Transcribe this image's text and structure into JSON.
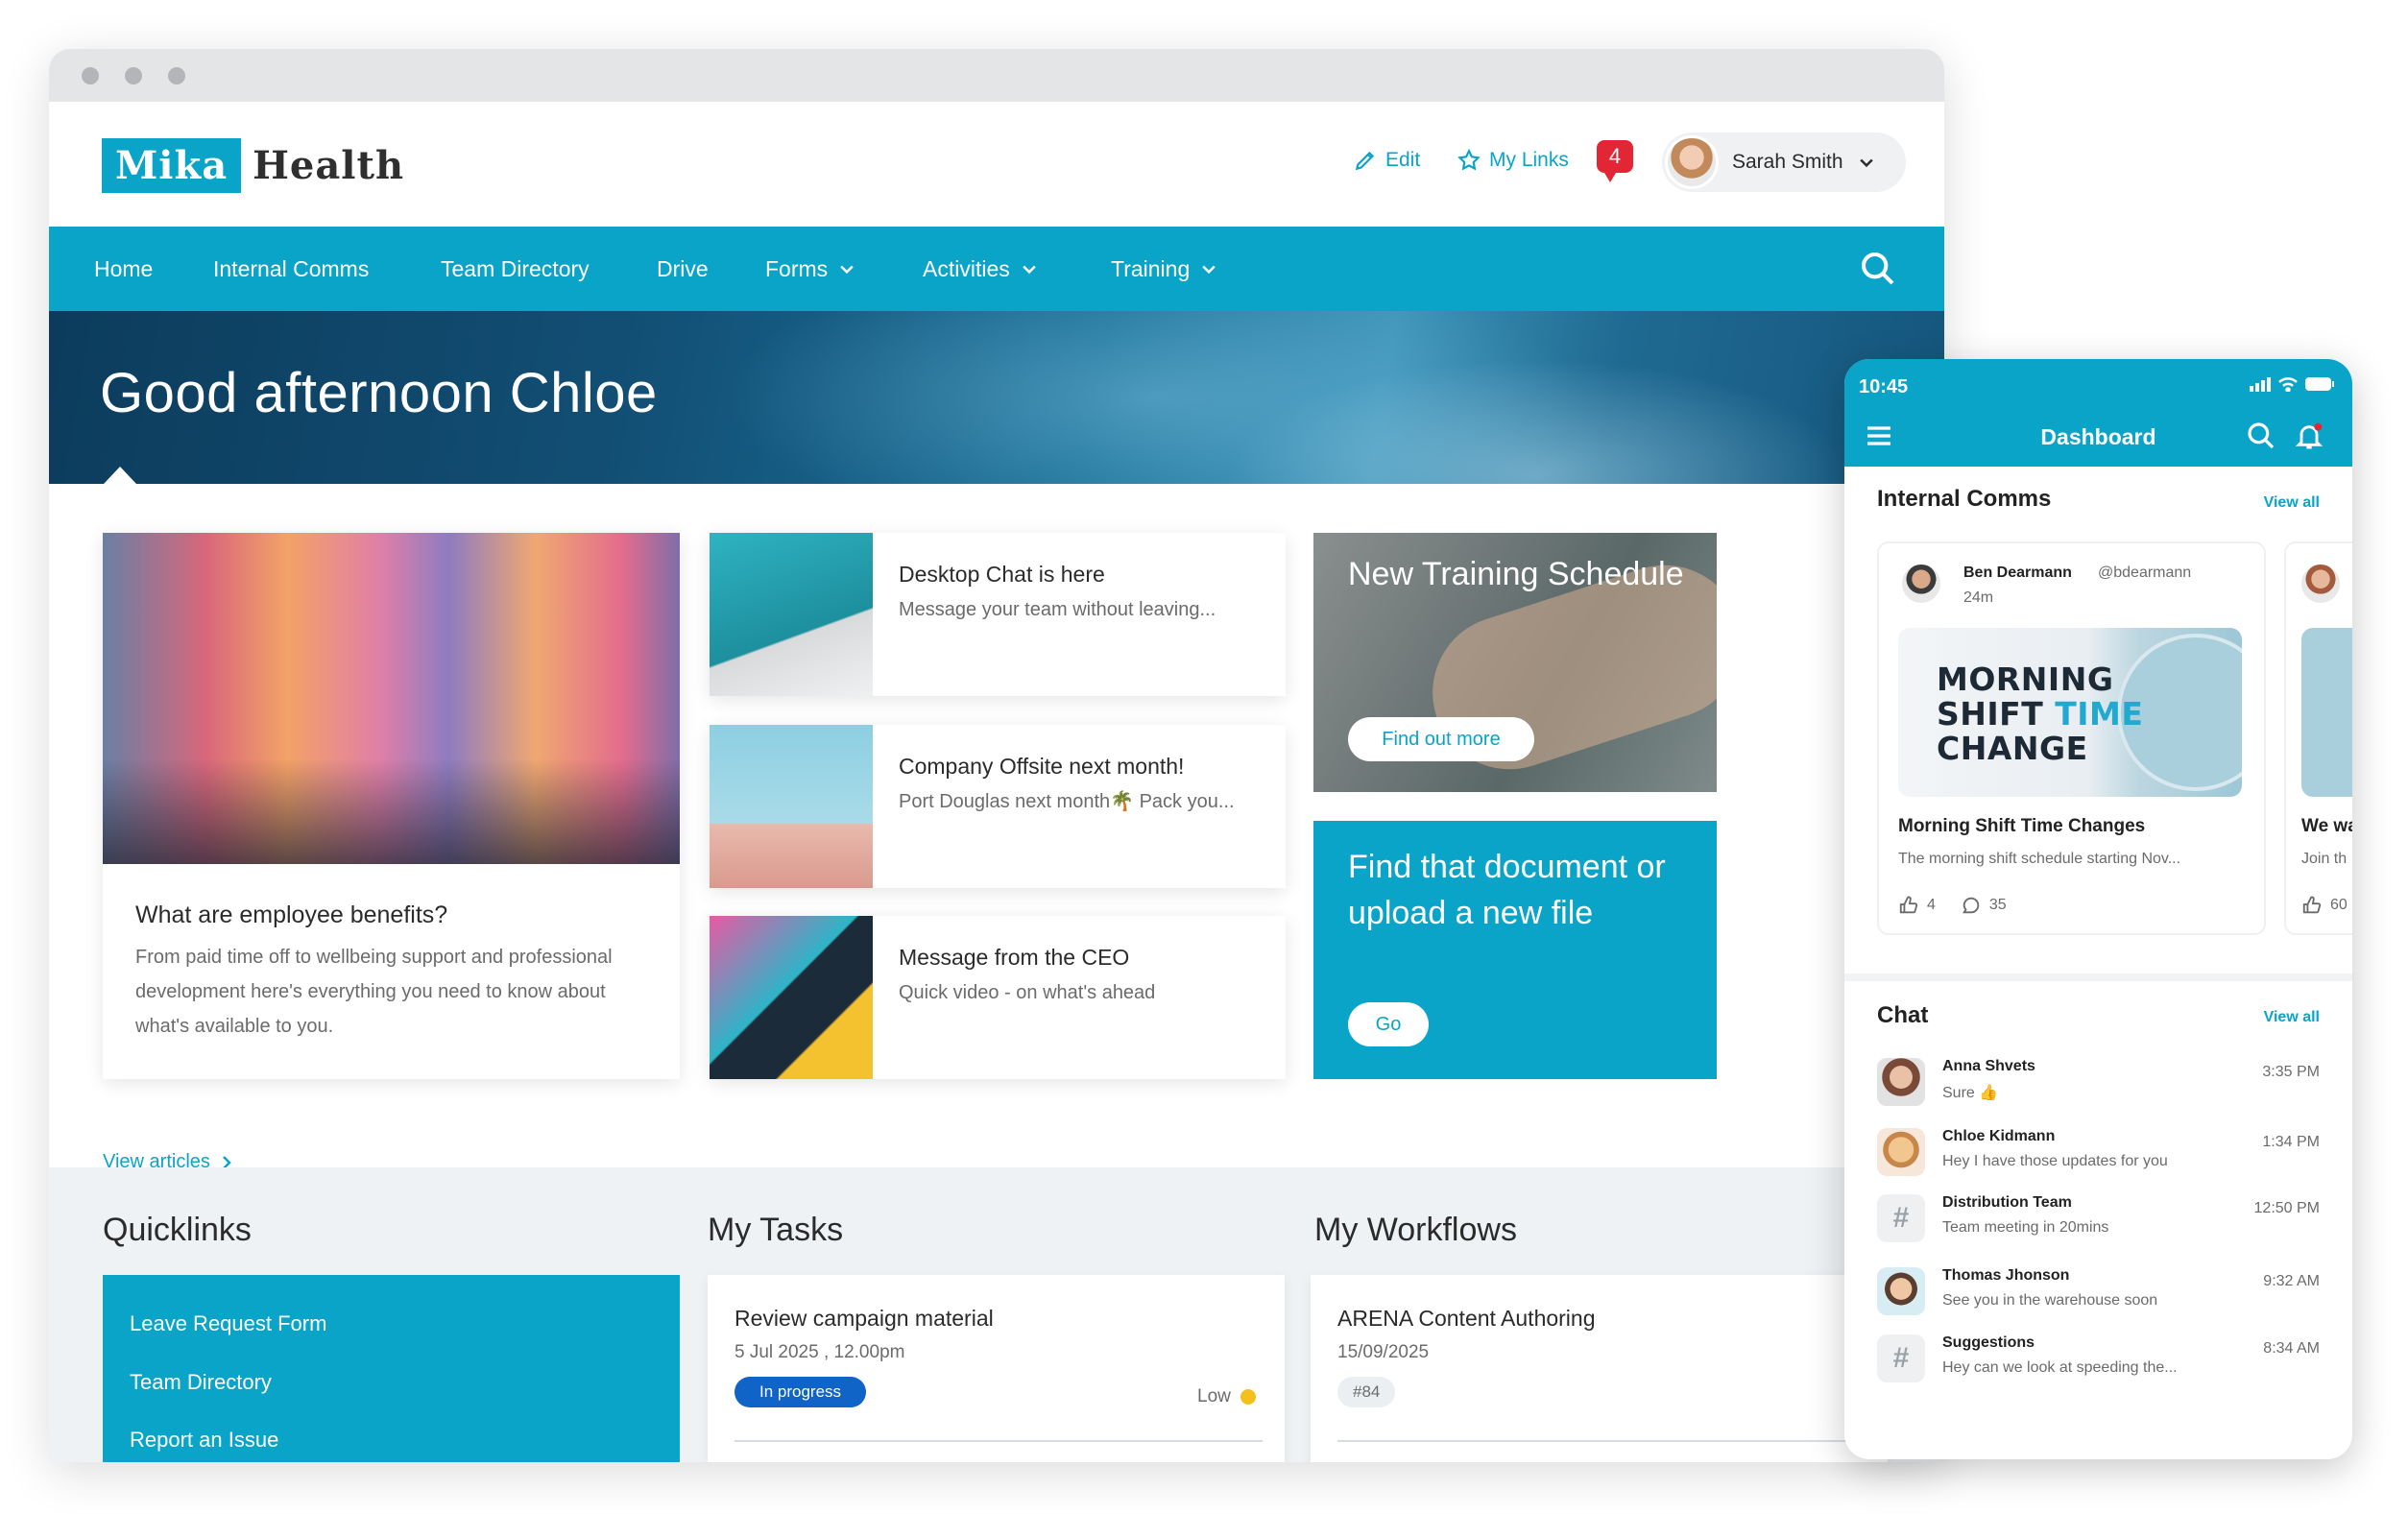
{
  "header": {
    "logo_box": "Mika",
    "logo_text": "Health",
    "edit_label": "Edit",
    "mylinks_label": "My Links",
    "notification_count": "4",
    "user_name": "Sarah Smith"
  },
  "nav": {
    "items": [
      "Home",
      "Internal Comms",
      "Team Directory",
      "Drive",
      "Forms",
      "Activities",
      "Training"
    ]
  },
  "hero": {
    "greeting": "Good afternoon Chloe"
  },
  "feature": {
    "title": "What are employee benefits?",
    "body": "From paid time off to wellbeing support and professional development here's everything you need to know about what's available to you."
  },
  "news": [
    {
      "title": "Desktop Chat is here",
      "sub": "Message your team without leaving..."
    },
    {
      "title": "Company Offsite next month!",
      "sub": "Port Douglas next month🌴 Pack you..."
    },
    {
      "title": "Message from the CEO",
      "sub": "Quick video - on what's ahead"
    }
  ],
  "view_articles": "View articles",
  "training": {
    "title": "New Training Schedule",
    "button": "Find out more"
  },
  "finddoc": {
    "title_line1": "Find that document or",
    "title_line2": "upload a new file",
    "button": "Go"
  },
  "quicklinks": {
    "title": "Quicklinks",
    "items": [
      "Leave Request Form",
      "Team Directory",
      "Report an Issue"
    ]
  },
  "tasks": {
    "title": "My Tasks",
    "item": {
      "title": "Review campaign material",
      "date": "5 Jul 2025 , 12.00pm",
      "status": "In progress",
      "priority": "Low"
    }
  },
  "workflows": {
    "title": "My Workflows",
    "item": {
      "title": "ARENA Content Authoring",
      "date": "15/09/2025",
      "tag": "#84"
    }
  },
  "phone": {
    "time": "10:45",
    "title": "Dashboard",
    "comms_title": "Internal Comms",
    "view_all": "View all",
    "post": {
      "author": "Ben Dearmann",
      "handle": "@bdearmann",
      "ago": "24m",
      "img_line1": "MORNING",
      "img_line2a": "SHIFT",
      "img_line2b": "TIME",
      "img_line3": "CHANGE",
      "title": "Morning Shift Time Changes",
      "body": "The morning shift schedule starting Nov...",
      "likes": "4",
      "comments": "35"
    },
    "post2": {
      "title": "We wa",
      "body": "Join th",
      "likes": "60"
    },
    "chat_title": "Chat",
    "chats": [
      {
        "name": "Anna Shvets",
        "msg": "Sure 👍",
        "time": "3:35 PM"
      },
      {
        "name": "Chloe Kidmann",
        "msg": "Hey I have those updates for you",
        "time": "1:34 PM"
      },
      {
        "name": "Distribution Team",
        "msg": "Team meeting in 20mins",
        "time": "12:50 PM"
      },
      {
        "name": "Thomas Jhonson",
        "msg": "See you in the warehouse soon",
        "time": "9:32 AM"
      },
      {
        "name": "Suggestions",
        "msg": "Hey can we look at speeding the...",
        "time": "8:34 AM"
      }
    ]
  },
  "colors": {
    "brand": "#0aa4c8",
    "badge_blue": "#1064c8",
    "alert_red": "#e32636",
    "priority_yellow": "#f4c01b"
  }
}
